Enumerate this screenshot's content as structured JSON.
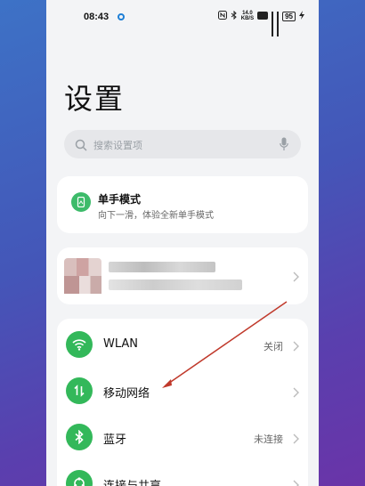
{
  "status_bar": {
    "time": "08:43",
    "net_speed_top": "14.0",
    "net_speed_bottom": "KB/S",
    "battery": "95"
  },
  "page_title": "设置",
  "search": {
    "placeholder": "搜索设置项"
  },
  "one_hand": {
    "title": "单手模式",
    "subtitle": "向下一滑，体验全新单手模式"
  },
  "settings": [
    {
      "label": "WLAN",
      "value": "关闭",
      "icon": "wifi-icon"
    },
    {
      "label": "移动网络",
      "value": "",
      "icon": "mobile-data-icon"
    },
    {
      "label": "蓝牙",
      "value": "未连接",
      "icon": "bluetooth-icon"
    },
    {
      "label": "连接与共享",
      "value": "",
      "icon": "share-icon"
    }
  ],
  "colors": {
    "accent": "#33b85a",
    "annotation": "#c0392b"
  }
}
